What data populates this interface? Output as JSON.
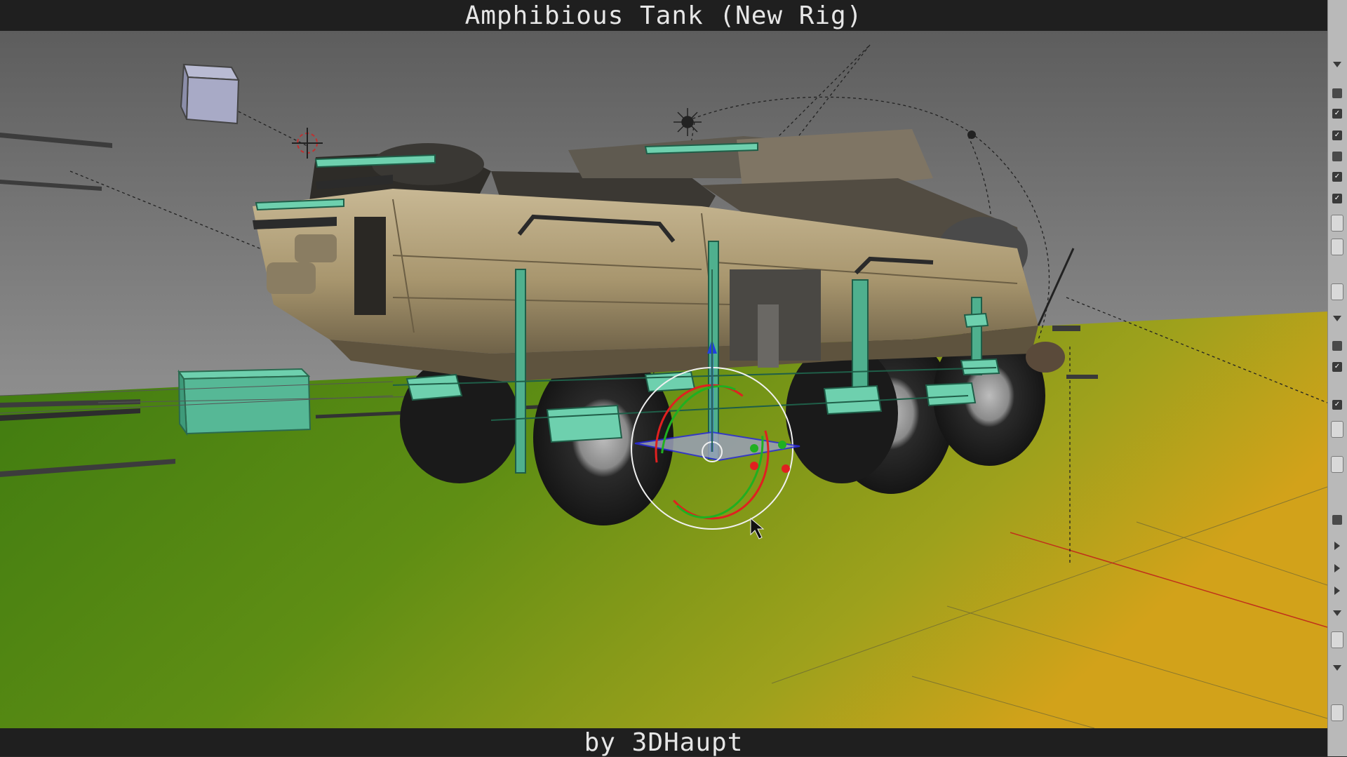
{
  "window": {
    "title": "Amphibious Tank (New Rig)",
    "author": "by 3DHaupt"
  },
  "viewport": {
    "scene": "3d-viewport",
    "colors": {
      "background_top": "#6e6e6e",
      "background_bottom": "#9a9a9a",
      "ground_left": "#3f7a12",
      "ground_right": "#c9a418",
      "tank_body": "#a89a78",
      "rig_bone": "#3fbf9a",
      "gizmo_x": "#e02020",
      "gizmo_y": "#20b020",
      "gizmo_z": "#2050e0"
    }
  },
  "side_panel": {
    "icons": [
      "checkbox-icon",
      "expand-triangle-icon",
      "field-icon"
    ]
  }
}
